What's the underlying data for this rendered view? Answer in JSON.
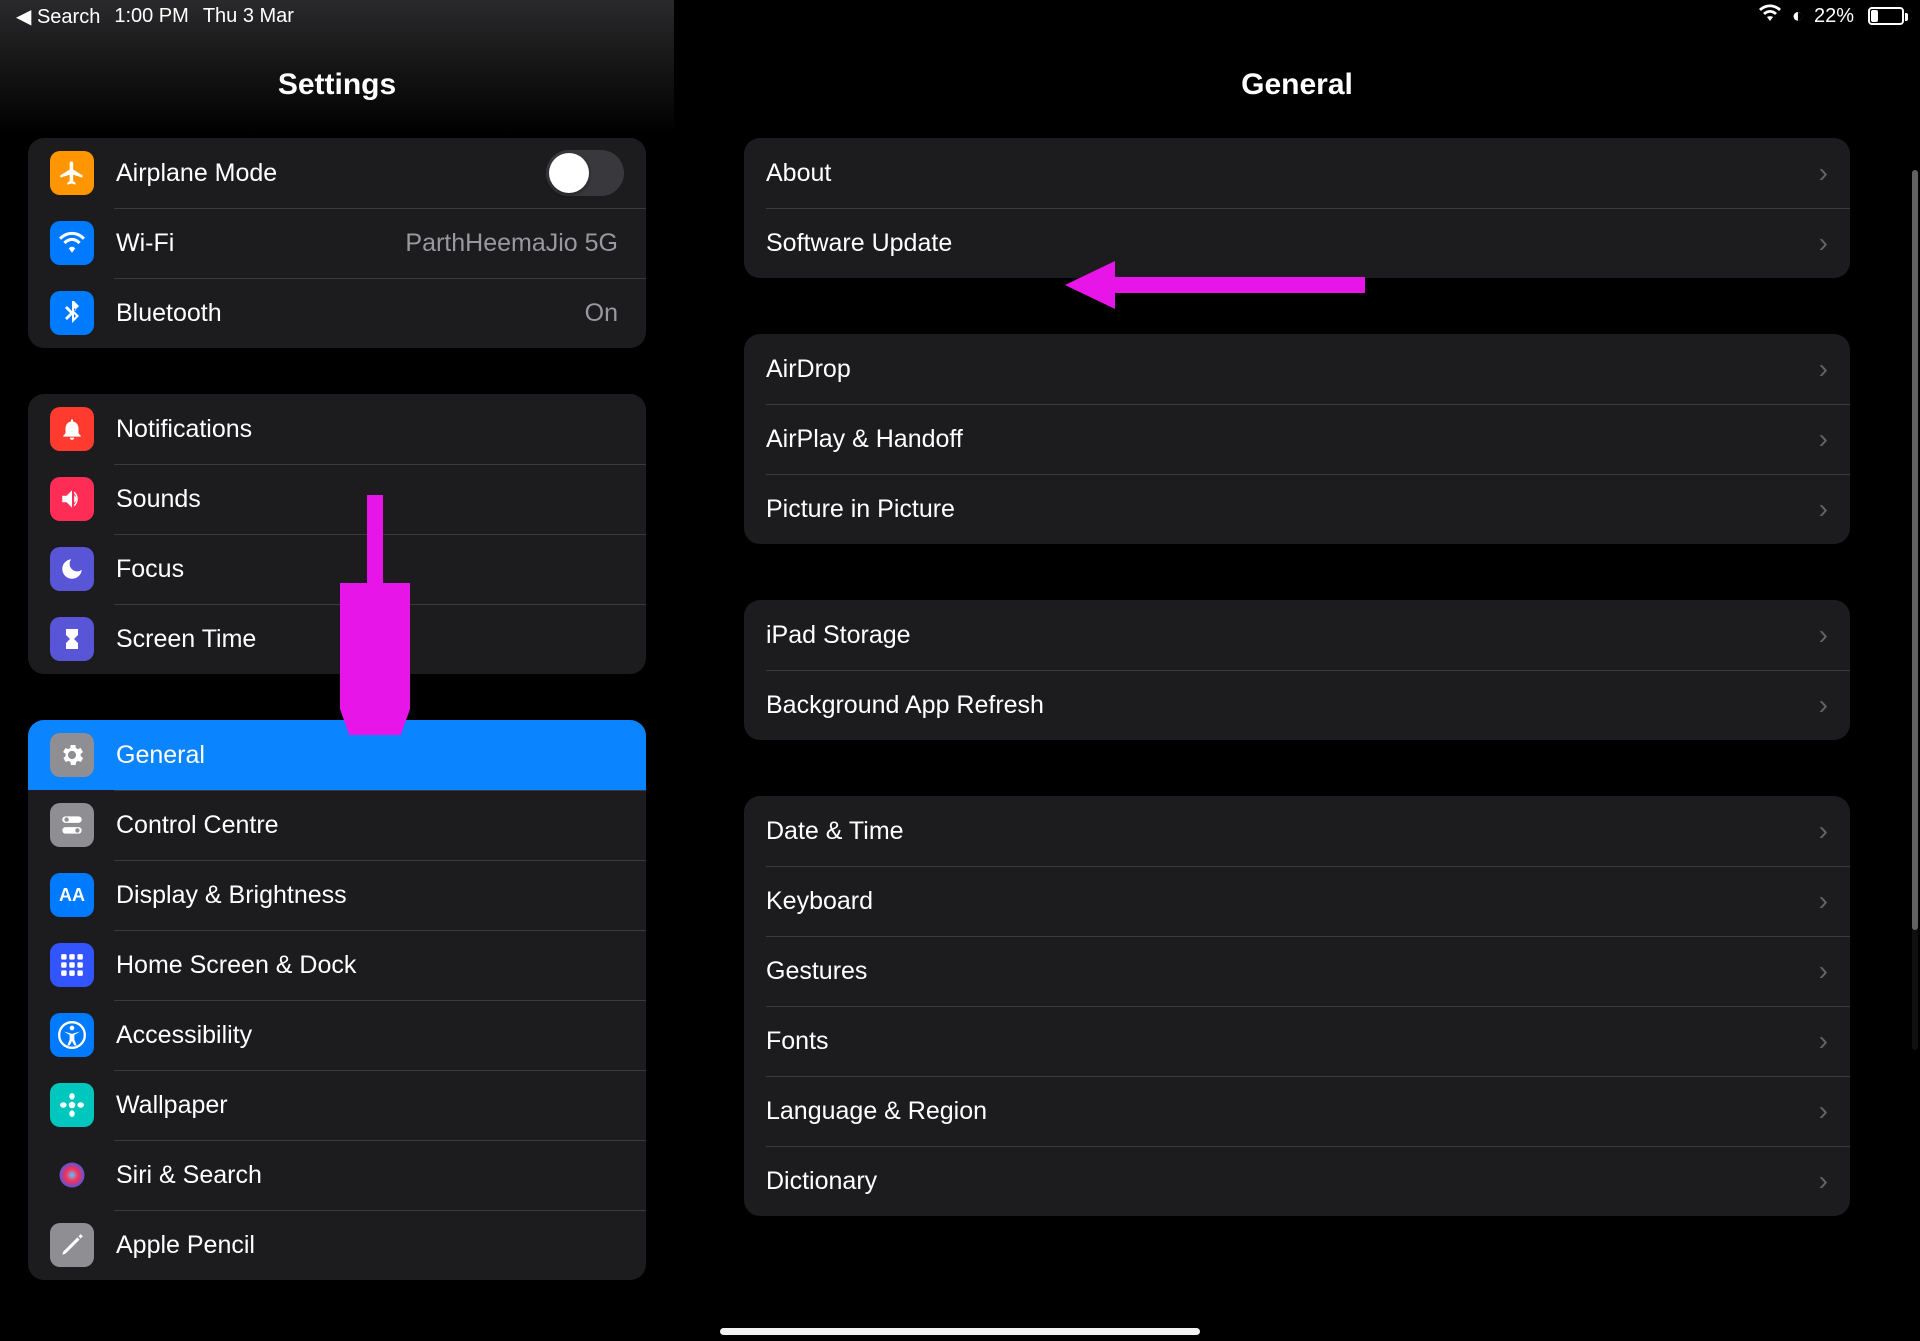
{
  "status": {
    "back_label": "Search",
    "time": "1:00 PM",
    "date": "Thu 3 Mar",
    "battery_pct": "22%"
  },
  "sidebar": {
    "title": "Settings",
    "groups": [
      {
        "items": [
          {
            "id": "airplane-mode",
            "label": "Airplane Mode",
            "icon": "airplane-icon",
            "icon_bg": "#ff9500",
            "toggle": true,
            "toggle_on": false
          },
          {
            "id": "wifi",
            "label": "Wi-Fi",
            "icon": "wifi-icon",
            "icon_bg": "#007aff",
            "value": "ParthHeemaJio 5G"
          },
          {
            "id": "bluetooth",
            "label": "Bluetooth",
            "icon": "bluetooth-icon",
            "icon_bg": "#007aff",
            "value": "On"
          }
        ]
      },
      {
        "items": [
          {
            "id": "notifications",
            "label": "Notifications",
            "icon": "bell-icon",
            "icon_bg": "#ff3b30"
          },
          {
            "id": "sounds",
            "label": "Sounds",
            "icon": "speaker-icon",
            "icon_bg": "#ff2d55"
          },
          {
            "id": "focus",
            "label": "Focus",
            "icon": "moon-icon",
            "icon_bg": "#5856d6"
          },
          {
            "id": "screen-time",
            "label": "Screen Time",
            "icon": "hourglass-icon",
            "icon_bg": "#5856d6"
          }
        ]
      },
      {
        "items": [
          {
            "id": "general",
            "label": "General",
            "icon": "gear-icon",
            "icon_bg": "#8e8e93",
            "selected": true
          },
          {
            "id": "control-centre",
            "label": "Control Centre",
            "icon": "switches-icon",
            "icon_bg": "#8e8e93"
          },
          {
            "id": "display-brightness",
            "label": "Display & Brightness",
            "icon": "text-size-icon",
            "icon_bg": "#007aff"
          },
          {
            "id": "home-screen-dock",
            "label": "Home Screen & Dock",
            "icon": "grid-icon",
            "icon_bg": "#3355ff"
          },
          {
            "id": "accessibility",
            "label": "Accessibility",
            "icon": "accessibility-icon",
            "icon_bg": "#007aff"
          },
          {
            "id": "wallpaper",
            "label": "Wallpaper",
            "icon": "flower-icon",
            "icon_bg": "#00c7be"
          },
          {
            "id": "siri-search",
            "label": "Siri & Search",
            "icon": "siri-icon",
            "icon_bg": "#1c1c1e"
          },
          {
            "id": "apple-pencil",
            "label": "Apple Pencil",
            "icon": "pencil-icon",
            "icon_bg": "#8e8e93"
          }
        ]
      }
    ]
  },
  "detail": {
    "title": "General",
    "groups": [
      {
        "items": [
          {
            "id": "about",
            "label": "About"
          },
          {
            "id": "software-update",
            "label": "Software Update"
          }
        ]
      },
      {
        "items": [
          {
            "id": "airdrop",
            "label": "AirDrop"
          },
          {
            "id": "airplay-handoff",
            "label": "AirPlay & Handoff"
          },
          {
            "id": "picture-in-picture",
            "label": "Picture in Picture"
          }
        ]
      },
      {
        "items": [
          {
            "id": "ipad-storage",
            "label": "iPad Storage"
          },
          {
            "id": "background-app-refresh",
            "label": "Background App Refresh"
          }
        ]
      },
      {
        "items": [
          {
            "id": "date-time",
            "label": "Date & Time"
          },
          {
            "id": "keyboard",
            "label": "Keyboard"
          },
          {
            "id": "gestures",
            "label": "Gestures"
          },
          {
            "id": "fonts",
            "label": "Fonts"
          },
          {
            "id": "language-region",
            "label": "Language & Region"
          },
          {
            "id": "dictionary",
            "label": "Dictionary"
          }
        ]
      }
    ]
  },
  "annotations": {
    "arrow_color": "#e815e8"
  }
}
